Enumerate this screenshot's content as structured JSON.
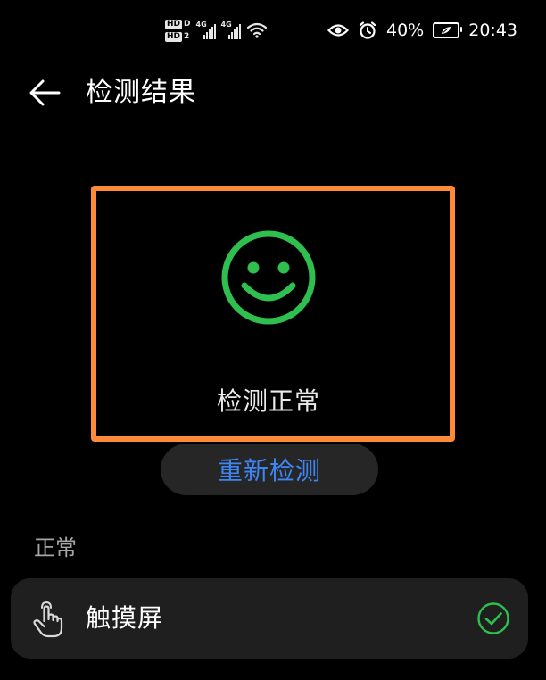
{
  "status_bar": {
    "hd_badges": [
      {
        "label": "HD",
        "sub": "D"
      },
      {
        "label": "HD",
        "sub": "2"
      }
    ],
    "signal_label_1": "4G",
    "signal_label_2": "4G",
    "battery_text": "40%",
    "time": "20:43",
    "icons": [
      "eye-comfort-icon",
      "alarm-icon",
      "battery-icon",
      "wifi-icon"
    ]
  },
  "header": {
    "title": "检测结果",
    "back_icon": "arrow-left-icon"
  },
  "result": {
    "status_text": "检测正常",
    "icon": "smiley-icon",
    "icon_color": "#2fbf4f",
    "highlight_color": "#ff8a3a"
  },
  "retest_button": {
    "label": "重新检测",
    "color": "#3e86f5"
  },
  "section": {
    "label": "正常"
  },
  "items": [
    {
      "label": "触摸屏",
      "icon": "touch-hand-icon",
      "status_icon": "check-circle-icon",
      "status_color": "#2fbf4f"
    }
  ]
}
